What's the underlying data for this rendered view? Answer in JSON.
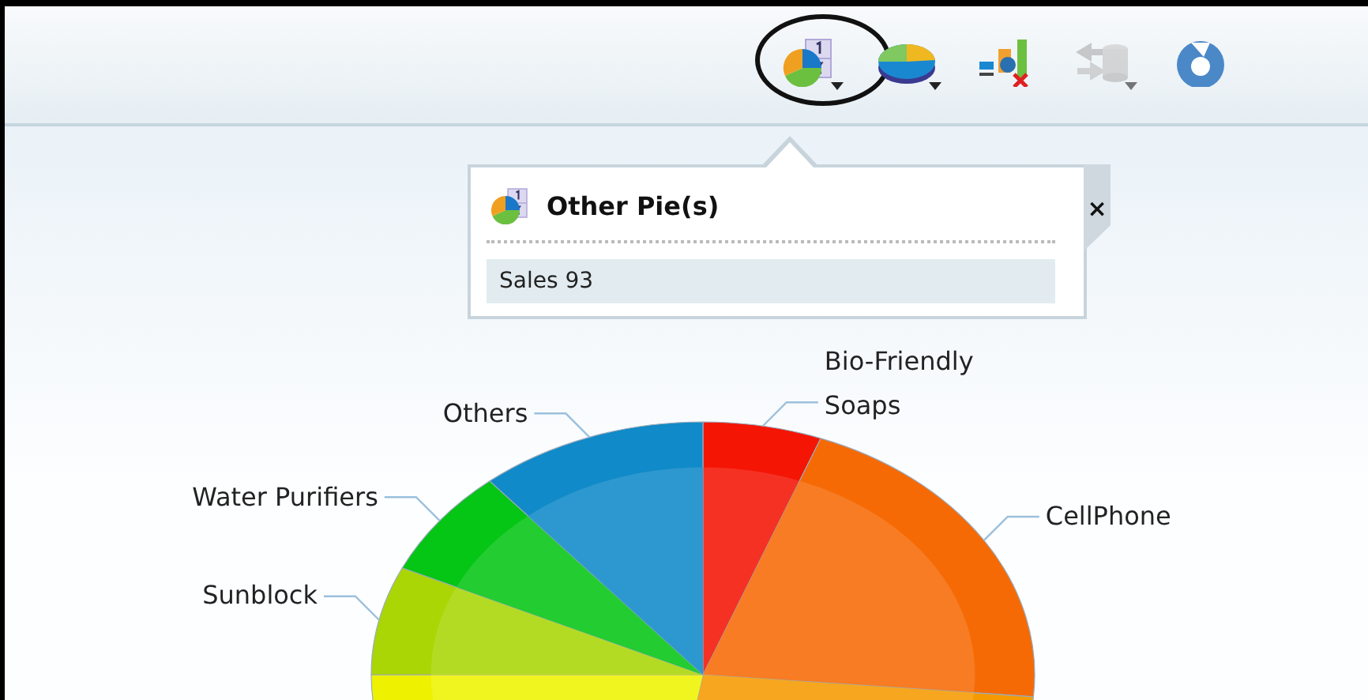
{
  "toolbar": {
    "buttons": [
      {
        "kind": "pie_table",
        "selected": true,
        "disabled": false,
        "dropdown": true
      },
      {
        "kind": "pie_3d",
        "selected": false,
        "disabled": false,
        "dropdown": true
      },
      {
        "kind": "chart_clear",
        "selected": false,
        "disabled": false,
        "dropdown": false
      },
      {
        "kind": "data_sync",
        "selected": false,
        "disabled": true,
        "dropdown": true
      },
      {
        "kind": "refresh",
        "selected": false,
        "disabled": false,
        "dropdown": false
      }
    ]
  },
  "popup": {
    "title": "Other Pie(s)",
    "close": "×",
    "items": [
      {
        "label": "Sales 93"
      }
    ]
  },
  "pie": {
    "slices": [
      {
        "label": "Bio-Friendly Soaps",
        "color": "#f41505"
      },
      {
        "label": "CellPhone",
        "color": "#f66a05"
      },
      {
        "color": "#f59a00"
      },
      {
        "color": "#eef200"
      },
      {
        "label": "Sunblock",
        "color": "#aad605"
      },
      {
        "label": "Water Purifiers",
        "color": "#05c515"
      },
      {
        "label": "Others",
        "color": "#108ac8"
      }
    ]
  }
}
